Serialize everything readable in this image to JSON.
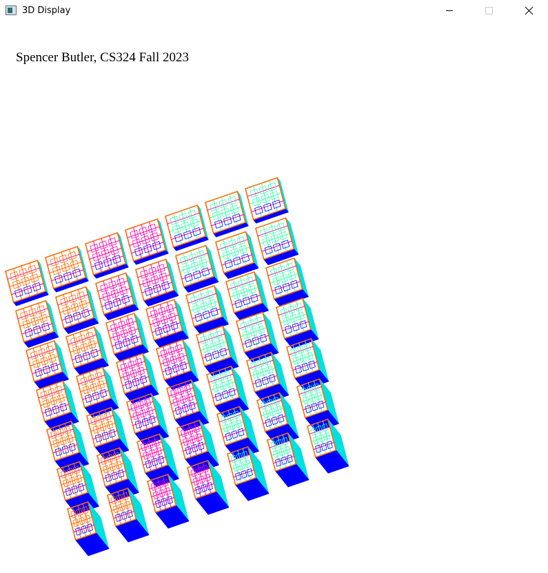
{
  "window": {
    "title": "3D Display",
    "icon": "app-window-icon",
    "controls": [
      "minimize-icon",
      "maximize-icon",
      "close-icon"
    ]
  },
  "canvas": {
    "caption": "Spencer Butler, CS324 Fall 2023",
    "scene": "wireframe-cube-grid",
    "colors": {
      "left_faces": "#ff6a00",
      "right_faces": "#00e0e0",
      "accent": "#ff00aa",
      "bottom_faces": "#0000ff",
      "light_faces": "#40ffb0"
    }
  }
}
